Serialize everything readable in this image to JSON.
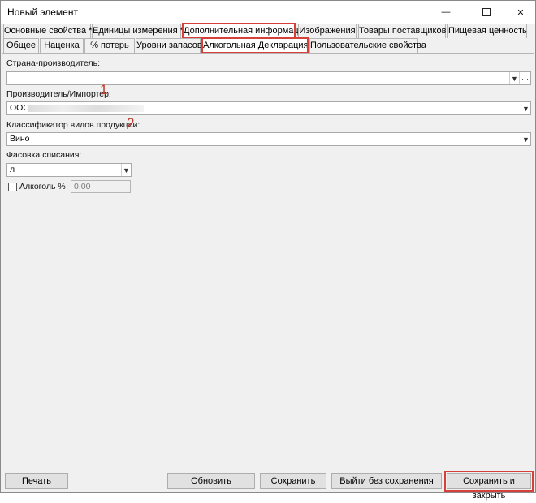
{
  "window": {
    "title": "Новый элемент"
  },
  "tabs_primary": [
    {
      "label": "Основные свойства *"
    },
    {
      "label": "Единицы измерения *"
    },
    {
      "label": "Дополнительная информация"
    },
    {
      "label": "Изображения"
    },
    {
      "label": "Товары поставщиков"
    },
    {
      "label": "Пищевая ценность"
    }
  ],
  "tabs_secondary": [
    {
      "label": "Общее"
    },
    {
      "label": "Наценка"
    },
    {
      "label": "% потерь"
    },
    {
      "label": "Уровни запасов"
    },
    {
      "label": "Алкогольная Декларация"
    },
    {
      "label": "Пользовательские свойства"
    }
  ],
  "form": {
    "country_label": "Страна-производитель:",
    "country_value": "",
    "producer_label": "Производитель/Импортер:",
    "producer_value": "ООО",
    "producer_marker": "1",
    "classifier_label": "Классификатор видов продукции:",
    "classifier_value": "Вино",
    "classifier_marker": "2",
    "packaging_label": "Фасовка списания:",
    "packaging_value": "л",
    "alcohol_label": "Алкоголь %",
    "alcohol_value": "0,00"
  },
  "footer": {
    "print": "Печать",
    "refresh": "Обновить",
    "save": "Сохранить",
    "exit_no_save": "Выйти без сохранения",
    "save_close": "Сохранить и закрыть"
  }
}
